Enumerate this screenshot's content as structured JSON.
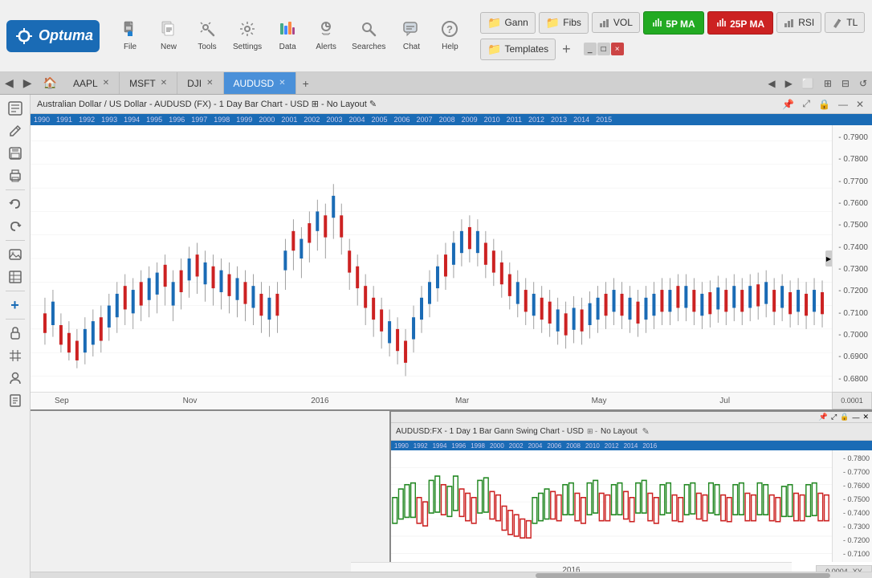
{
  "app": {
    "name": "Optuma",
    "logo_text": "Optuma"
  },
  "toolbar": {
    "buttons": [
      {
        "id": "file",
        "label": "File",
        "icon": "📄"
      },
      {
        "id": "new",
        "label": "New",
        "icon": "📋"
      },
      {
        "id": "tools",
        "label": "Tools",
        "icon": "🔧"
      },
      {
        "id": "settings",
        "label": "Settings",
        "icon": "⚙"
      },
      {
        "id": "data",
        "label": "Data",
        "icon": "📊"
      },
      {
        "id": "alerts",
        "label": "Alerts",
        "icon": "⏰"
      },
      {
        "id": "searches",
        "label": "Searches",
        "icon": "🔍"
      },
      {
        "id": "chat",
        "label": "Chat",
        "icon": "💬"
      },
      {
        "id": "help",
        "label": "Help",
        "icon": "❓"
      }
    ],
    "right_buttons": [
      {
        "id": "gann",
        "label": "Gann",
        "type": "folder"
      },
      {
        "id": "fibs",
        "label": "Fibs",
        "type": "folder"
      },
      {
        "id": "vol",
        "label": "VOL",
        "type": "chart"
      },
      {
        "id": "5pma",
        "label": "5P MA",
        "type": "green"
      },
      {
        "id": "25pma",
        "label": "25P MA",
        "type": "red"
      },
      {
        "id": "rsi",
        "label": "RSI",
        "type": "chart"
      },
      {
        "id": "tl",
        "label": "TL",
        "type": "edit"
      },
      {
        "id": "templates",
        "label": "Templates",
        "type": "folder"
      }
    ],
    "plus_label": "+",
    "win_buttons": [
      "_",
      "□",
      "×"
    ]
  },
  "tabs": {
    "items": [
      {
        "id": "aapl",
        "label": "AAPL",
        "closable": true,
        "active": false
      },
      {
        "id": "msft",
        "label": "MSFT",
        "closable": true,
        "active": false
      },
      {
        "id": "djl",
        "label": "DJI",
        "closable": true,
        "active": false
      },
      {
        "id": "audusd",
        "label": "AUDUSD",
        "closable": true,
        "active": true
      },
      {
        "id": "new",
        "label": "",
        "closable": false,
        "active": false
      }
    ]
  },
  "upper_chart": {
    "title": "Australian Dollar / US Dollar - AUDUSD (FX) - 1 Day Bar Chart - USD",
    "layout": "No Layout",
    "time_labels": [
      "1990",
      "1991",
      "1992",
      "1993",
      "1994",
      "1995",
      "1996",
      "1997",
      "1998",
      "1999",
      "2000",
      "2001",
      "2002",
      "2003",
      "2004",
      "2005",
      "2006",
      "2007",
      "2008",
      "2009",
      "2010",
      "2011",
      "2012",
      "2013",
      "2014",
      "2015"
    ],
    "bottom_labels": [
      "Sep",
      "Nov",
      "2016",
      "Mar",
      "May",
      "Jul"
    ],
    "price_labels": [
      "0.7900",
      "0.7800",
      "0.7700",
      "0.7600",
      "0.7500",
      "0.7400",
      "0.7300",
      "0.7200",
      "0.7100",
      "0.7000",
      "0.6900",
      "0.6800"
    ]
  },
  "lower_chart": {
    "title": "AUDUSD:FX - 1 Day 1 Bar Gann Swing Chart - USD",
    "layout": "No Layout",
    "price_labels": [
      "0.7800",
      "0.7700",
      "0.7600",
      "0.7500",
      "0.7400",
      "0.7300",
      "0.7200",
      "0.7100"
    ],
    "bottom_label": "2016",
    "time_labels": [
      "1990",
      "1992",
      "1994",
      "1996",
      "1998",
      "2000",
      "2002",
      "2004",
      "2006",
      "2008",
      "2010",
      "2012",
      "2014",
      "2016"
    ]
  },
  "status": {
    "upper_zoom": "0.0001",
    "lower_zoom": "0.0004",
    "coord": "XY"
  },
  "sidebar": {
    "buttons": [
      "⊞",
      "✎",
      "💾",
      "🖨",
      "↩",
      "↪",
      "🖼",
      "📋",
      "🔧",
      "➕",
      "🔒",
      "#",
      "👤",
      "📋"
    ]
  }
}
